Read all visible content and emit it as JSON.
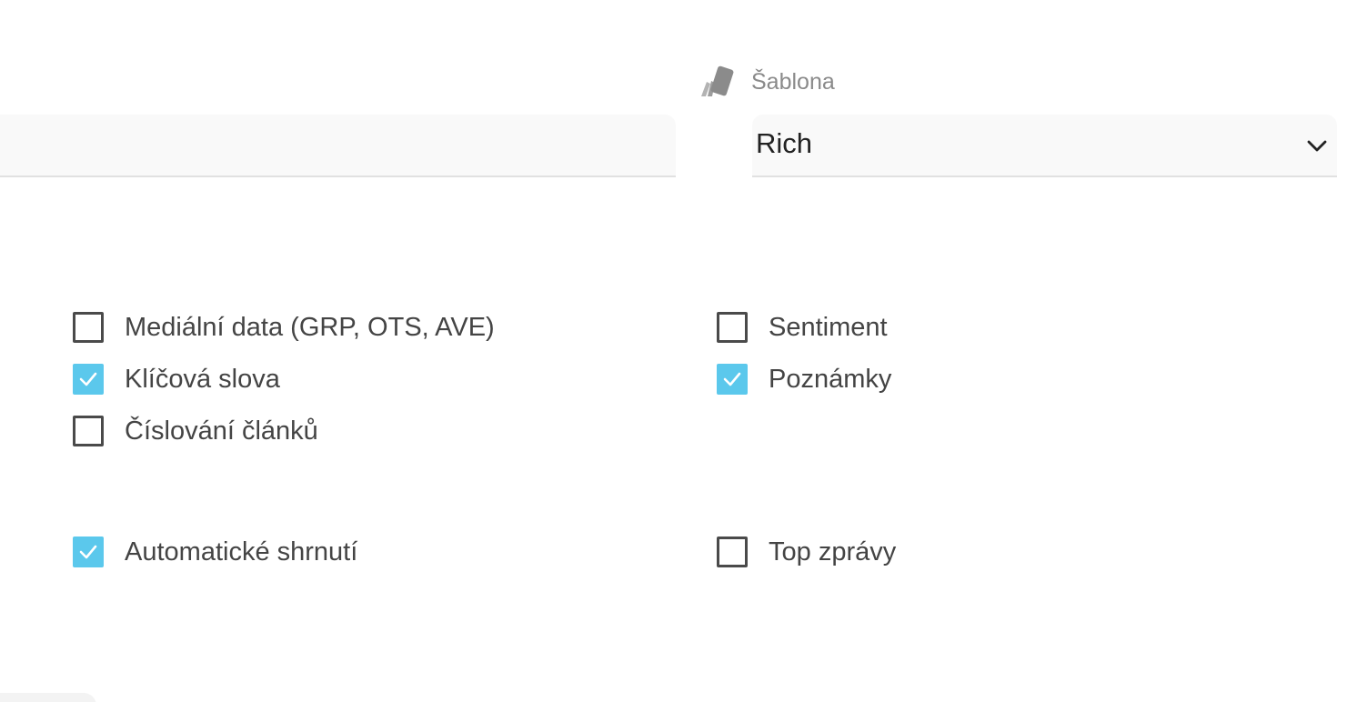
{
  "template": {
    "label": "Šablona",
    "selected": "Rich",
    "icon": "cards-icon"
  },
  "options": [
    {
      "id": "media-data",
      "label": "Mediální data (GRP, OTS, AVE)",
      "checked": false
    },
    {
      "id": "keywords",
      "label": "Klíčová slova",
      "checked": true
    },
    {
      "id": "article-numbering",
      "label": "Číslování článků",
      "checked": false
    },
    {
      "id": "sentiment",
      "label": "Sentiment",
      "checked": false
    },
    {
      "id": "notes",
      "label": "Poznámky",
      "checked": true
    },
    {
      "id": "auto-summary",
      "label": "Automatické shrnutí",
      "checked": true
    },
    {
      "id": "top-news",
      "label": "Top zprávy",
      "checked": false
    }
  ],
  "colors": {
    "checkbox_checked": "#5bc8ec",
    "field_background": "#f9f9f9"
  }
}
